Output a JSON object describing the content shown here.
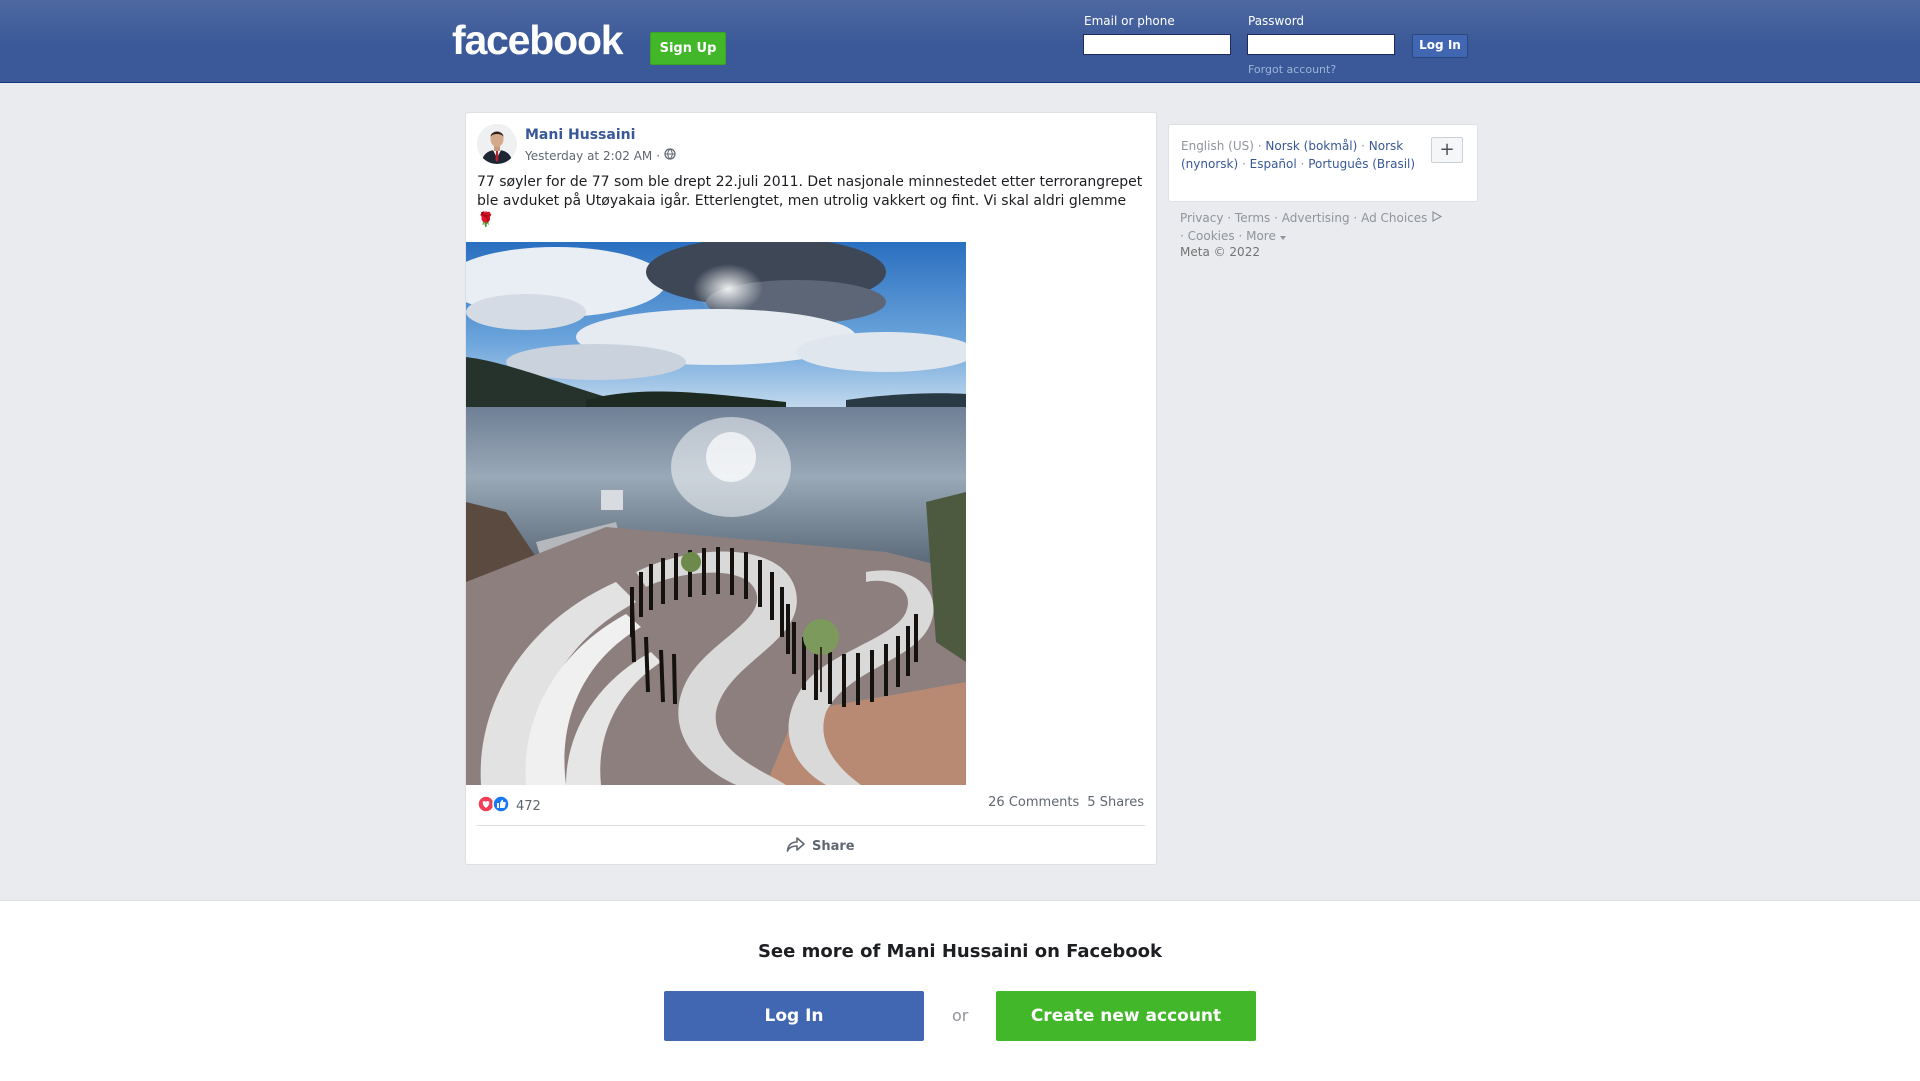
{
  "header": {
    "logo": "facebook",
    "signup_label": "Sign Up",
    "email_label": "Email or phone",
    "password_label": "Password",
    "login_label": "Log In",
    "forgot_label": "Forgot account?"
  },
  "post": {
    "author": "Mani Hussaini",
    "timestamp": "Yesterday at 2:02 AM",
    "meta_separator": "·",
    "audience_icon": "globe-icon",
    "text": "77 søyler for de 77 som ble drept 22.juli 2011. Det nasjonale minnestedet etter terrorangrepet ble avduket på Utøyakaia igår. Etterlengtet, men utrolig vakkert og fint. Vi skal aldri glemme",
    "emoji": "🌹",
    "reactions": [
      "love",
      "like"
    ],
    "reaction_count": "472",
    "comments": "26 Comments",
    "shares": "5 Shares",
    "share_label": "Share"
  },
  "sidebar": {
    "languages": {
      "current": "English (US)",
      "others": [
        "Norsk (bokmål)",
        "Norsk (nynorsk)",
        "Español",
        "Português (Brasil)"
      ],
      "more_button": "+"
    },
    "footer_links": [
      "Privacy",
      "Terms",
      "Advertising",
      "Ad Choices",
      "Cookies",
      "More"
    ],
    "copyright": "Meta © 2022"
  },
  "banner": {
    "title": "See more of Mani Hussaini on Facebook",
    "login_label": "Log In",
    "or_label": "or",
    "create_label": "Create new account"
  },
  "colors": {
    "brand_blue": "#3b5998",
    "button_blue": "#4267b2",
    "green": "#42b72a",
    "link": "#385898"
  }
}
